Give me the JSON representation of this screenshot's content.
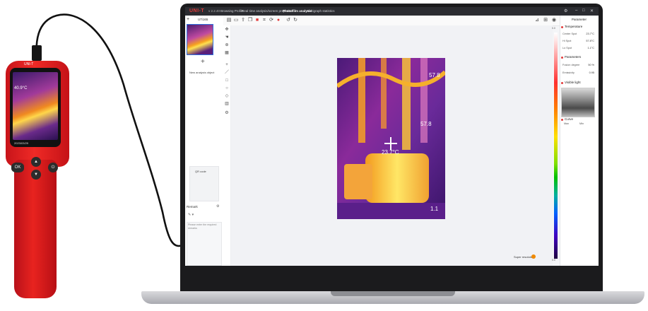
{
  "device": {
    "temperature": "40.9°C",
    "date": "2023/03/29",
    "ok_label": "OK",
    "brand": "UNI-T"
  },
  "app": {
    "logo": "UNI-T",
    "version": "v 2.2.40",
    "menu": [
      {
        "label": "Browsing Profile",
        "active": false
      },
      {
        "label": "Real time analysis/screen projection",
        "active": false
      },
      {
        "label": "Photo/film analysis",
        "active": true
      },
      {
        "label": "Multigraph statistics",
        "active": false
      }
    ]
  },
  "left_panel": {
    "device_name": "UTi165",
    "add_analysis_label": "New analysis object",
    "qr_label": "QR code",
    "remark_title": "Remark",
    "remark_placeholder": "Please enter the required remarks"
  },
  "image": {
    "max_temp": "57.8",
    "spot_temp": "57.8",
    "center_temp": "23.7°C",
    "min_temp": "1.1"
  },
  "palette": {
    "top_label": "0.0",
    "bottom_label": "0.0"
  },
  "canvas": {
    "super_resolution_label": "Super resolution"
  },
  "right_panel": {
    "title": "Parameter",
    "temperature_section": "Temperature",
    "center_spot_label": "Center Spot",
    "center_spot_value": "23.7°C",
    "hi_spot_label": "Hi Spot",
    "hi_spot_value": "57.8°C",
    "lo_spot_label": "Lo Spot",
    "lo_spot_value": "1.1°C",
    "parameters_section": "Parameters",
    "fusion_label": "Fusion degree",
    "fusion_value": "50 %",
    "emissivity_label": "Emissivity",
    "emissivity_value": "0.95",
    "visible_section": "Visible light",
    "curve_section": "Curve",
    "curve_max": "Max",
    "curve_min": "Min"
  }
}
